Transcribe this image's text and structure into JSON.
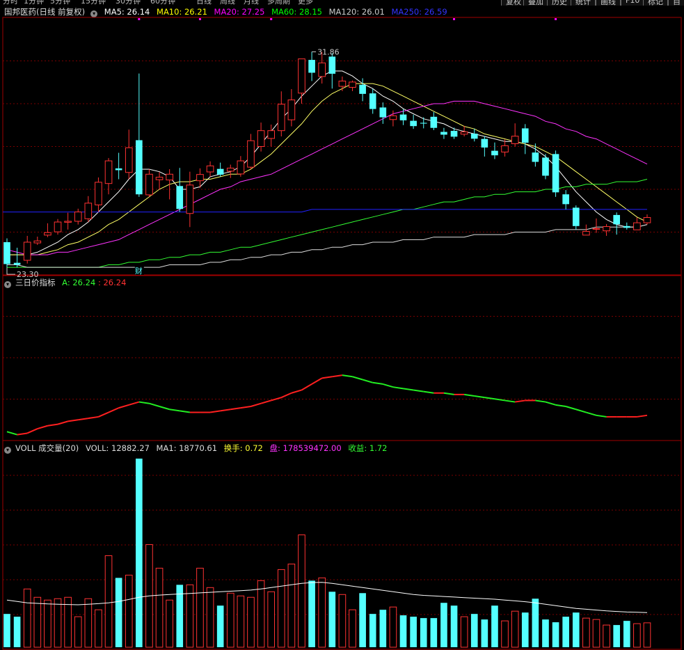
{
  "top_bar": {
    "periods": [
      "分时",
      "1分钟",
      "5分钟",
      "15分钟",
      "30分钟",
      "60分钟",
      "日线",
      "周线",
      "月线",
      "多周期",
      "更多"
    ],
    "buttons": [
      "复权",
      "叠加",
      "历史",
      "统计",
      "画线",
      "F10",
      "标记",
      "自"
    ]
  },
  "price_panel": {
    "title": "国邦医药(日线 前复权)",
    "ma": [
      {
        "label": "MA5: 26.14",
        "color": "#ffffff"
      },
      {
        "label": "MA10: 26.21",
        "color": "#ffff00"
      },
      {
        "label": "MA20: 27.25",
        "color": "#ff00ff"
      },
      {
        "label": "MA60: 28.15",
        "color": "#00ff00"
      },
      {
        "label": "MA120: 26.01",
        "color": "#cccccc"
      },
      {
        "label": "MA250: 26.59",
        "color": "#3333ff"
      }
    ],
    "high_label": "31.86",
    "low_label": "23.30",
    "finance_mark": "财"
  },
  "indicator_panel": {
    "title": "三日价指标",
    "a_label": "A: 26.24",
    "b_label": ": 26.24"
  },
  "volume_panel": {
    "title": "VOLL 成交量(20)",
    "voll": "VOLL: 12882.27",
    "ma1": "MA1: 18770.61",
    "turnover": "换手: 0.72",
    "pan": "盘: 178539472.00",
    "income": "收益: 1.72"
  },
  "colors": {
    "up": "#ff3232",
    "down": "#54ffff",
    "grid": "#7a0000",
    "border": "#a00000",
    "ma5": "#ffffff",
    "ma10": "#ffff66",
    "ma20": "#ff33ff",
    "ma60": "#33ff33",
    "ma120": "#dddddd",
    "ma250": "#2222ff"
  },
  "chart_data": {
    "type": "candlestick",
    "ylim": [
      23.0,
      33.2
    ],
    "candles": [
      [
        24.3,
        23.43,
        24.45,
        23.3
      ],
      [
        23.48,
        23.4,
        24.08,
        23.3
      ],
      [
        23.58,
        24.3,
        24.55,
        23.45
      ],
      [
        24.27,
        24.35,
        24.52,
        24.19
      ],
      [
        24.58,
        24.68,
        25.05,
        24.5
      ],
      [
        24.71,
        25.1,
        25.22,
        24.6
      ],
      [
        25.09,
        25.13,
        25.47,
        24.8
      ],
      [
        25.13,
        25.5,
        25.63,
        25.0
      ],
      [
        25.23,
        25.85,
        26.13,
        25.1
      ],
      [
        25.78,
        26.68,
        26.87,
        25.5
      ],
      [
        26.63,
        27.53,
        27.64,
        26.2
      ],
      [
        27.23,
        27.16,
        27.85,
        26.8
      ],
      [
        27.07,
        28.05,
        28.77,
        26.8
      ],
      [
        28.35,
        26.2,
        31.0,
        26.1
      ],
      [
        26.18,
        27.0,
        27.2,
        26.1
      ],
      [
        26.78,
        26.88,
        27.08,
        26.38
      ],
      [
        26.77,
        27.0,
        27.2,
        26.0
      ],
      [
        26.53,
        25.62,
        27.25,
        25.5
      ],
      [
        25.44,
        26.57,
        27.1,
        24.9
      ],
      [
        26.74,
        26.99,
        27.23,
        26.45
      ],
      [
        27.09,
        27.33,
        27.51,
        26.9
      ],
      [
        27.21,
        26.98,
        27.46,
        26.9
      ],
      [
        27.12,
        27.24,
        27.38,
        26.85
      ],
      [
        27.01,
        27.53,
        27.72,
        26.9
      ],
      [
        27.28,
        28.33,
        28.6,
        27.2
      ],
      [
        28.1,
        28.73,
        29.05,
        27.9
      ],
      [
        28.42,
        28.73,
        28.97,
        28.1
      ],
      [
        28.73,
        29.78,
        30.29,
        28.5
      ],
      [
        29.16,
        29.95,
        30.38,
        28.9
      ],
      [
        30.22,
        31.58,
        31.58,
        29.8
      ],
      [
        31.54,
        31.03,
        31.86,
        30.7
      ],
      [
        30.88,
        31.42,
        31.86,
        30.6
      ],
      [
        31.67,
        30.99,
        31.81,
        30.4
      ],
      [
        30.49,
        30.7,
        30.88,
        30.3
      ],
      [
        30.45,
        30.66,
        30.72,
        30.3
      ],
      [
        30.55,
        30.19,
        30.81,
        29.9
      ],
      [
        30.21,
        29.59,
        30.39,
        29.4
      ],
      [
        29.65,
        29.26,
        29.85,
        29.0
      ],
      [
        29.17,
        29.32,
        29.53,
        28.9
      ],
      [
        29.37,
        29.14,
        29.58,
        28.95
      ],
      [
        29.12,
        28.91,
        29.36,
        28.8
      ],
      [
        29.04,
        29.01,
        29.26,
        28.82
      ],
      [
        29.28,
        28.84,
        29.47,
        28.75
      ],
      [
        28.68,
        28.57,
        28.84,
        28.4
      ],
      [
        28.72,
        28.49,
        28.85,
        28.4
      ],
      [
        28.59,
        28.68,
        28.92,
        28.5
      ],
      [
        28.61,
        28.41,
        28.81,
        28.3
      ],
      [
        28.4,
        28.06,
        28.51,
        27.7
      ],
      [
        27.93,
        27.75,
        28.26,
        27.6
      ],
      [
        27.88,
        28.13,
        28.38,
        27.7
      ],
      [
        28.21,
        28.51,
        29.02,
        28.1
      ],
      [
        28.82,
        28.25,
        28.99,
        27.8
      ],
      [
        27.86,
        27.49,
        28.22,
        27.3
      ],
      [
        27.66,
        26.94,
        27.8,
        26.8
      ],
      [
        27.8,
        26.28,
        27.94,
        26.1
      ],
      [
        26.2,
        25.81,
        26.37,
        25.6
      ],
      [
        25.67,
        24.94,
        25.76,
        24.8
      ],
      [
        24.58,
        24.73,
        25.0,
        24.7
      ],
      [
        24.82,
        24.84,
        25.24,
        24.67
      ],
      [
        24.75,
        24.92,
        25.02,
        24.55
      ],
      [
        25.38,
        25.01,
        25.48,
        24.6
      ],
      [
        24.94,
        24.87,
        25.08,
        24.8
      ],
      [
        24.79,
        25.07,
        25.28,
        24.78
      ],
      [
        25.07,
        25.28,
        25.4,
        25.0
      ]
    ],
    "ma_lines": [
      {
        "name": "MA5",
        "values": [
          23.8,
          23.8,
          23.8,
          23.9,
          24.1,
          24.3,
          24.6,
          24.8,
          25.1,
          25.5,
          25.9,
          26.3,
          26.8,
          27.2,
          27.2,
          27.1,
          26.9,
          26.4,
          26.4,
          26.5,
          26.9,
          27.0,
          27.1,
          27.3,
          27.7,
          28.2,
          28.7,
          29.2,
          29.6,
          30.1,
          30.5,
          30.9,
          31.1,
          31.1,
          30.9,
          30.6,
          30.4,
          30.1,
          29.9,
          29.6,
          29.4,
          29.2,
          29.1,
          29.0,
          28.8,
          28.7,
          28.6,
          28.5,
          28.4,
          28.3,
          28.3,
          28.2,
          28.0,
          27.7,
          27.3,
          26.8,
          26.3,
          25.9,
          25.5,
          25.2,
          25.0,
          24.9,
          24.9,
          25.0
        ]
      },
      {
        "name": "MA10",
        "values": [
          23.8,
          23.8,
          23.8,
          23.8,
          23.9,
          24.0,
          24.2,
          24.3,
          24.5,
          24.7,
          25.0,
          25.2,
          25.5,
          25.8,
          26.1,
          26.4,
          26.6,
          26.7,
          26.7,
          26.8,
          26.8,
          26.9,
          27.0,
          27.0,
          27.2,
          27.5,
          27.8,
          28.2,
          28.6,
          29.0,
          29.5,
          29.9,
          30.2,
          30.4,
          30.6,
          30.6,
          30.6,
          30.5,
          30.3,
          30.1,
          29.9,
          29.7,
          29.5,
          29.3,
          29.1,
          28.9,
          28.8,
          28.6,
          28.5,
          28.4,
          28.3,
          28.2,
          28.1,
          27.9,
          27.7,
          27.4,
          27.1,
          26.8,
          26.5,
          26.2,
          25.9,
          25.6,
          25.3,
          25.1
        ]
      },
      {
        "name": "MA20",
        "values": [
          24.0,
          23.9,
          23.8,
          23.8,
          23.8,
          23.9,
          23.9,
          24.0,
          24.1,
          24.2,
          24.3,
          24.4,
          24.6,
          24.8,
          25.0,
          25.2,
          25.4,
          25.6,
          25.8,
          26.0,
          26.2,
          26.4,
          26.5,
          26.7,
          26.8,
          26.9,
          27.0,
          27.2,
          27.4,
          27.6,
          27.8,
          28.0,
          28.2,
          28.4,
          28.6,
          28.8,
          29.0,
          29.2,
          29.4,
          29.5,
          29.6,
          29.7,
          29.8,
          29.8,
          29.9,
          29.9,
          29.9,
          29.8,
          29.7,
          29.6,
          29.5,
          29.4,
          29.3,
          29.1,
          29.0,
          28.8,
          28.7,
          28.5,
          28.4,
          28.2,
          28.0,
          27.8,
          27.6,
          27.4
        ]
      },
      {
        "name": "MA60",
        "values": [
          23.3,
          23.3,
          23.3,
          23.3,
          23.3,
          23.3,
          23.3,
          23.3,
          23.3,
          23.3,
          23.4,
          23.4,
          23.5,
          23.5,
          23.6,
          23.6,
          23.7,
          23.7,
          23.8,
          23.8,
          23.9,
          23.9,
          24.0,
          24.1,
          24.1,
          24.2,
          24.3,
          24.4,
          24.5,
          24.6,
          24.7,
          24.8,
          24.9,
          25.0,
          25.1,
          25.2,
          25.3,
          25.4,
          25.5,
          25.6,
          25.6,
          25.7,
          25.8,
          25.9,
          25.9,
          26.0,
          26.1,
          26.1,
          26.2,
          26.2,
          26.3,
          26.3,
          26.3,
          26.4,
          26.4,
          26.5,
          26.5,
          26.6,
          26.6,
          26.6,
          26.7,
          26.7,
          26.7,
          26.8
        ]
      },
      {
        "name": "MA120",
        "values": [
          23.4,
          23.4,
          23.3,
          23.3,
          23.3,
          23.3,
          23.3,
          23.3,
          23.3,
          23.3,
          23.3,
          23.3,
          23.3,
          23.3,
          23.3,
          23.3,
          23.4,
          23.4,
          23.4,
          23.4,
          23.5,
          23.5,
          23.6,
          23.6,
          23.7,
          23.7,
          23.8,
          23.8,
          23.9,
          23.9,
          24.0,
          24.0,
          24.1,
          24.1,
          24.2,
          24.2,
          24.3,
          24.3,
          24.3,
          24.4,
          24.4,
          24.4,
          24.5,
          24.5,
          24.5,
          24.5,
          24.6,
          24.6,
          24.6,
          24.6,
          24.7,
          24.7,
          24.7,
          24.7,
          24.8,
          24.8,
          24.8,
          24.8,
          24.9,
          24.9,
          24.9,
          24.9,
          24.9,
          25.0
        ]
      },
      {
        "name": "MA250",
        "values": [
          25.5,
          25.5,
          25.5,
          25.5,
          25.5,
          25.5,
          25.5,
          25.5,
          25.5,
          25.5,
          25.5,
          25.5,
          25.5,
          25.5,
          25.5,
          25.5,
          25.5,
          25.5,
          25.5,
          25.5,
          25.5,
          25.5,
          25.5,
          25.5,
          25.5,
          25.5,
          25.5,
          25.5,
          25.5,
          25.5,
          25.6,
          25.6,
          25.6,
          25.6,
          25.6,
          25.6,
          25.6,
          25.6,
          25.6,
          25.6,
          25.6,
          25.6,
          25.6,
          25.6,
          25.6,
          25.6,
          25.6,
          25.6,
          25.6,
          25.6,
          25.6,
          25.6,
          25.6,
          25.6,
          25.6,
          25.6,
          25.6,
          25.6,
          25.6,
          25.6,
          25.6,
          25.6,
          25.6,
          25.6
        ]
      }
    ],
    "indicator": {
      "ylim": [
        23.0,
        33.2
      ],
      "values": [
        23.5,
        23.3,
        23.4,
        23.7,
        23.9,
        24.0,
        24.2,
        24.3,
        24.4,
        24.5,
        24.8,
        25.1,
        25.3,
        25.5,
        25.4,
        25.2,
        25.0,
        24.9,
        24.8,
        24.8,
        24.8,
        24.9,
        25.0,
        25.1,
        25.2,
        25.4,
        25.6,
        25.8,
        26.1,
        26.3,
        26.7,
        27.1,
        27.2,
        27.3,
        27.2,
        27.0,
        26.8,
        26.7,
        26.5,
        26.4,
        26.3,
        26.2,
        26.1,
        26.1,
        26.0,
        26.0,
        25.9,
        25.8,
        25.7,
        25.6,
        25.5,
        25.6,
        25.6,
        25.5,
        25.3,
        25.2,
        25.0,
        24.8,
        24.6,
        24.5,
        24.5,
        24.5,
        24.5,
        24.6
      ]
    },
    "volume": {
      "ylim": [
        0,
        70000
      ],
      "values": [
        12000,
        11000,
        21000,
        18000,
        17000,
        17500,
        18000,
        11000,
        17500,
        13500,
        33000,
        25000,
        26000,
        68000,
        37000,
        28500,
        17000,
        22500,
        22500,
        28500,
        21500,
        15000,
        19500,
        18500,
        18000,
        24000,
        20000,
        28000,
        30000,
        40500,
        24000,
        25000,
        20000,
        19000,
        13500,
        19500,
        12000,
        13500,
        14500,
        11500,
        11000,
        10500,
        10500,
        16000,
        15000,
        11000,
        12000,
        10000,
        15000,
        9500,
        13000,
        12500,
        17500,
        10000,
        9000,
        11000,
        12500,
        10500,
        10000,
        8000,
        8000,
        9500,
        8500,
        8800
      ],
      "ma1": [
        17000,
        16500,
        16000,
        15800,
        15600,
        15500,
        15400,
        15300,
        15500,
        15700,
        16000,
        16500,
        17200,
        18000,
        18500,
        18800,
        19000,
        19200,
        19400,
        19600,
        19800,
        20000,
        20200,
        20400,
        20600,
        21000,
        21500,
        22000,
        22500,
        23000,
        23300,
        23400,
        23000,
        22500,
        22000,
        21500,
        21000,
        20500,
        20000,
        19500,
        19000,
        18700,
        18500,
        18300,
        18100,
        17900,
        17700,
        17500,
        17300,
        17000,
        16700,
        16400,
        16000,
        15500,
        15000,
        14500,
        14000,
        13700,
        13400,
        13100,
        12900,
        12700,
        12600,
        12500
      ]
    }
  }
}
